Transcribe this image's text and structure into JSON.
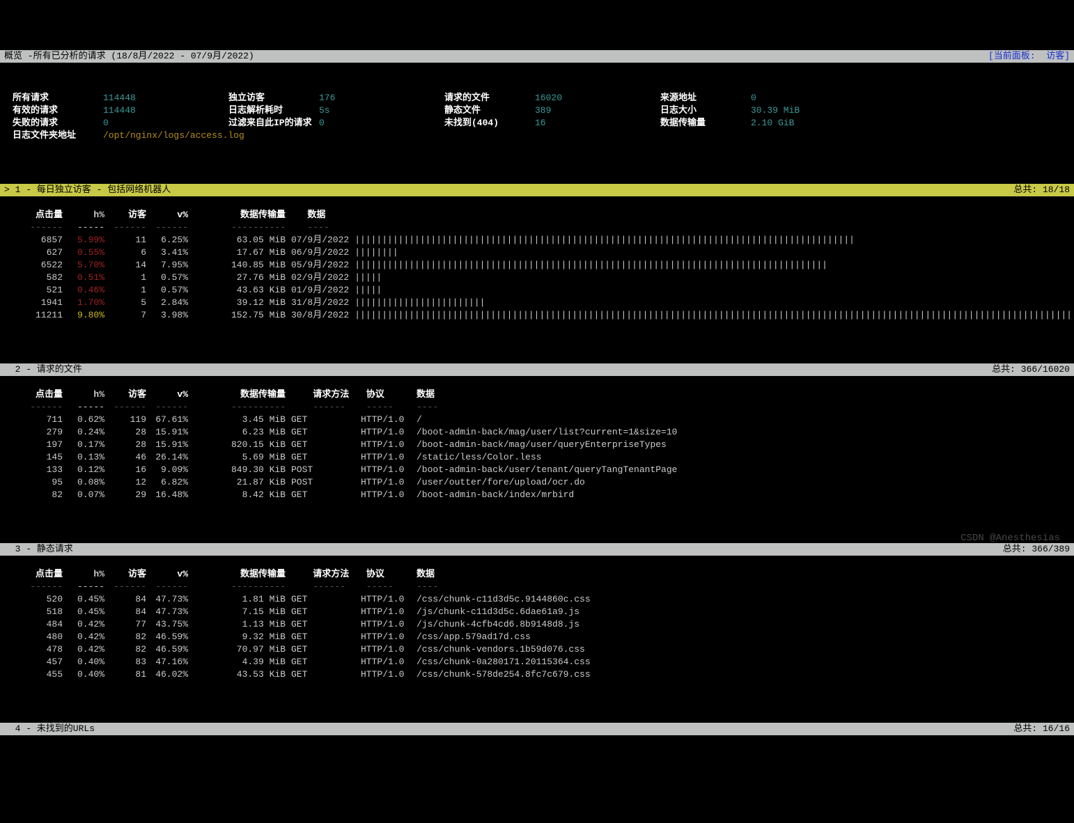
{
  "header": {
    "title": "概览 -所有已分析的请求 (18/8月/2022 - 07/9月/2022)",
    "right": "[当前面板:  访客]"
  },
  "overview": {
    "rows": [
      [
        {
          "label": "所有请求",
          "value": "114448"
        },
        {
          "label": "独立访客",
          "value": "176"
        },
        {
          "label": "请求的文件",
          "value": "16020"
        },
        {
          "label": "来源地址",
          "value": "0"
        }
      ],
      [
        {
          "label": "有效的请求",
          "value": "114448"
        },
        {
          "label": "日志解析耗时",
          "value": "5s"
        },
        {
          "label": "静态文件",
          "value": "389"
        },
        {
          "label": "日志大小",
          "value": "30.39 MiB"
        }
      ],
      [
        {
          "label": "失败的请求",
          "value": "0"
        },
        {
          "label": "过滤来自此IP的请求",
          "value": "0"
        },
        {
          "label": "未找到(404)",
          "value": "16"
        },
        {
          "label": "数据传输量",
          "value": "2.10 GiB"
        }
      ],
      [
        {
          "label": "日志文件夹地址",
          "value": "/opt/nginx/logs/access.log",
          "path": true
        }
      ]
    ]
  },
  "panel1": {
    "title": "> 1 - 每日独立访客 - 包括网络机器人",
    "total": "总共: 18/18",
    "headers": {
      "hits": "点击量",
      "hp": "h%",
      "vis": "访客",
      "vp": "v%",
      "bw": "数据传输量",
      "data": "数据"
    },
    "dashes": {
      "hits": "------",
      "hp": "-----",
      "vis": "------",
      "vp": "------",
      "bw": "----------",
      "data": "----"
    },
    "rows": [
      {
        "hits": "6857",
        "hp": "5.99%",
        "hpc": "red",
        "vis": "11",
        "vp": "6.25%",
        "bw": "63.05 MiB",
        "date": "07/9月/2022",
        "bar": "||||||||||||||||||||||||||||||||||||||||||||||||||||||||||||||||||||||||||||||||||||||||||||"
      },
      {
        "hits": "627",
        "hp": "0.55%",
        "hpc": "red",
        "vis": "6",
        "vp": "3.41%",
        "bw": "17.67 MiB",
        "date": "06/9月/2022",
        "bar": "||||||||"
      },
      {
        "hits": "6522",
        "hp": "5.70%",
        "hpc": "red",
        "vis": "14",
        "vp": "7.95%",
        "bw": "140.85 MiB",
        "date": "05/9月/2022",
        "bar": "|||||||||||||||||||||||||||||||||||||||||||||||||||||||||||||||||||||||||||||||||||||||"
      },
      {
        "hits": "582",
        "hp": "0.51%",
        "hpc": "red",
        "vis": "1",
        "vp": "0.57%",
        "bw": "27.76 MiB",
        "date": "02/9月/2022",
        "bar": "|||||"
      },
      {
        "hits": "521",
        "hp": "0.46%",
        "hpc": "red",
        "vis": "1",
        "vp": "0.57%",
        "bw": "43.63 KiB",
        "date": "01/9月/2022",
        "bar": "|||||"
      },
      {
        "hits": "1941",
        "hp": "1.70%",
        "hpc": "red",
        "vis": "5",
        "vp": "2.84%",
        "bw": "39.12 MiB",
        "date": "31/8月/2022",
        "bar": "||||||||||||||||||||||||"
      },
      {
        "hits": "11211",
        "hp": "9.80%",
        "hpc": "yellow",
        "vis": "7",
        "vp": "3.98%",
        "bw": "152.75 MiB",
        "date": "30/8月/2022",
        "bar": "||||||||||||||||||||||||||||||||||||||||||||||||||||||||||||||||||||||||||||||||||||||||||||||||||||||||||||||||||||||||||||||||||||||||||||||||||||"
      }
    ]
  },
  "panel2": {
    "title": "  2 - 请求的文件",
    "total": "总共: 366/16020",
    "headers": {
      "hits": "点击量",
      "hp": "h%",
      "vis": "访客",
      "vp": "v%",
      "bw": "数据传输量",
      "method": "请求方法",
      "proto": "协议",
      "data": "数据"
    },
    "dashes": {
      "hits": "------",
      "hp": "-----",
      "vis": "------",
      "vp": "------",
      "bw": "----------",
      "method": "------",
      "proto": "-----",
      "data": "----"
    },
    "rows": [
      {
        "hits": "711",
        "hp": "0.62%",
        "vis": "119",
        "vp": "67.61%",
        "bw": "3.45 MiB",
        "method": "GET",
        "proto": "HTTP/1.0",
        "data": "/"
      },
      {
        "hits": "279",
        "hp": "0.24%",
        "vis": "28",
        "vp": "15.91%",
        "bw": "6.23 MiB",
        "method": "GET",
        "proto": "HTTP/1.0",
        "data": "/boot-admin-back/mag/user/list?current=1&size=10"
      },
      {
        "hits": "197",
        "hp": "0.17%",
        "vis": "28",
        "vp": "15.91%",
        "bw": "820.15 KiB",
        "method": "GET",
        "proto": "HTTP/1.0",
        "data": "/boot-admin-back/mag/user/queryEnterpriseTypes"
      },
      {
        "hits": "145",
        "hp": "0.13%",
        "vis": "46",
        "vp": "26.14%",
        "bw": "5.69 MiB",
        "method": "GET",
        "proto": "HTTP/1.0",
        "data": "/static/less/Color.less"
      },
      {
        "hits": "133",
        "hp": "0.12%",
        "vis": "16",
        "vp": "9.09%",
        "bw": "849.30 KiB",
        "method": "POST",
        "proto": "HTTP/1.0",
        "data": "/boot-admin-back/user/tenant/queryTangTenantPage"
      },
      {
        "hits": "95",
        "hp": "0.08%",
        "vis": "12",
        "vp": "6.82%",
        "bw": "21.87 KiB",
        "method": "POST",
        "proto": "HTTP/1.0",
        "data": "/user/outter/fore/upload/ocr.do"
      },
      {
        "hits": "82",
        "hp": "0.07%",
        "vis": "29",
        "vp": "16.48%",
        "bw": "8.42 KiB",
        "method": "GET",
        "proto": "HTTP/1.0",
        "data": "/boot-admin-back/index/mrbird"
      }
    ]
  },
  "panel3": {
    "title": "  3 - 静态请求",
    "total": "总共: 366/389",
    "rows": [
      {
        "hits": "520",
        "hp": "0.45%",
        "vis": "84",
        "vp": "47.73%",
        "bw": "1.81 MiB",
        "method": "GET",
        "proto": "HTTP/1.0",
        "data": "/css/chunk-c11d3d5c.9144860c.css"
      },
      {
        "hits": "518",
        "hp": "0.45%",
        "vis": "84",
        "vp": "47.73%",
        "bw": "7.15 MiB",
        "method": "GET",
        "proto": "HTTP/1.0",
        "data": "/js/chunk-c11d3d5c.6dae61a9.js"
      },
      {
        "hits": "484",
        "hp": "0.42%",
        "vis": "77",
        "vp": "43.75%",
        "bw": "1.13 MiB",
        "method": "GET",
        "proto": "HTTP/1.0",
        "data": "/js/chunk-4cfb4cd6.8b9148d8.js"
      },
      {
        "hits": "480",
        "hp": "0.42%",
        "vis": "82",
        "vp": "46.59%",
        "bw": "9.32 MiB",
        "method": "GET",
        "proto": "HTTP/1.0",
        "data": "/css/app.579ad17d.css"
      },
      {
        "hits": "478",
        "hp": "0.42%",
        "vis": "82",
        "vp": "46.59%",
        "bw": "70.97 MiB",
        "method": "GET",
        "proto": "HTTP/1.0",
        "data": "/css/chunk-vendors.1b59d076.css"
      },
      {
        "hits": "457",
        "hp": "0.40%",
        "vis": "83",
        "vp": "47.16%",
        "bw": "4.39 MiB",
        "method": "GET",
        "proto": "HTTP/1.0",
        "data": "/css/chunk-0a280171.20115364.css"
      },
      {
        "hits": "455",
        "hp": "0.40%",
        "vis": "81",
        "vp": "46.02%",
        "bw": "43.53 KiB",
        "method": "GET",
        "proto": "HTTP/1.0",
        "data": "/css/chunk-578de254.8fc7c679.css"
      }
    ]
  },
  "panel4": {
    "title": "  4 - 未找到的URLs",
    "total": "总共: 16/16"
  },
  "watermark": "CSDN @Anesthesias"
}
